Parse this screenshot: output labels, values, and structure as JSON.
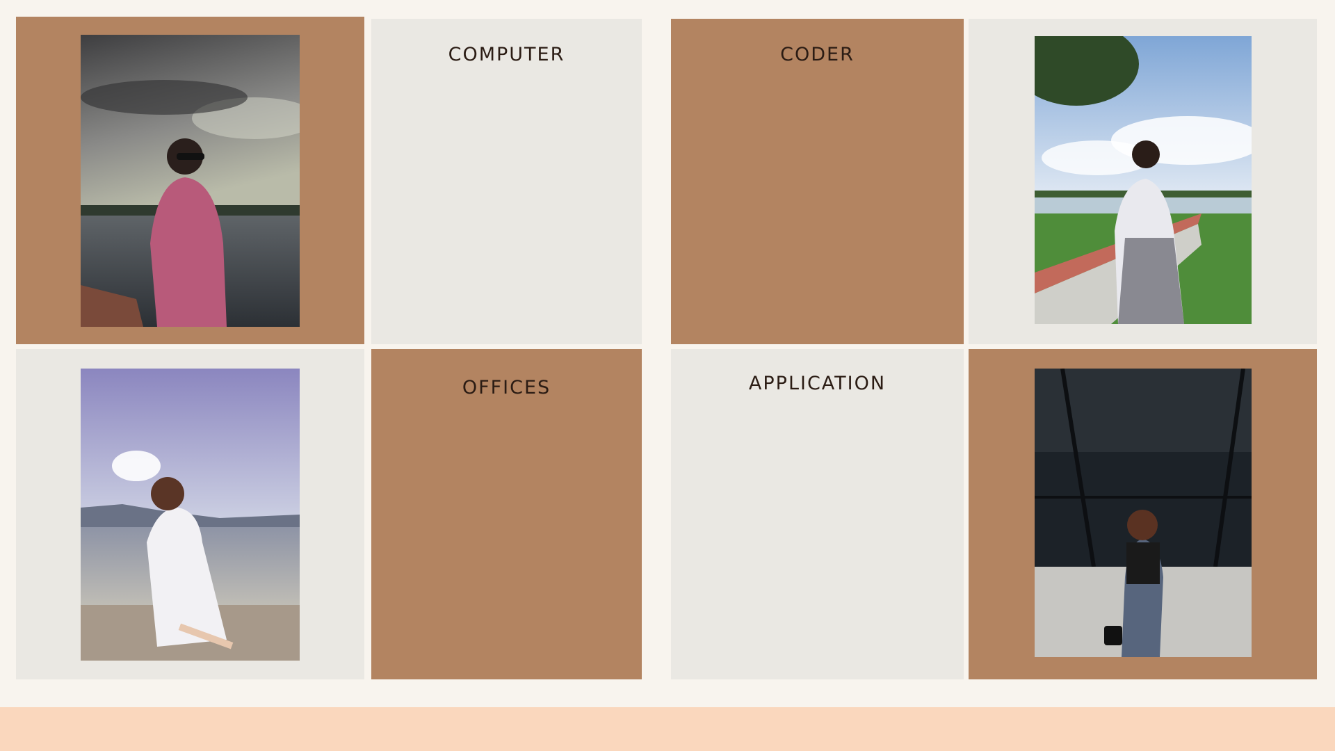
{
  "colors": {
    "page_background": "#f8f4ee",
    "tile_brown": "#b38461",
    "tile_gray": "#eae8e3",
    "label_text": "#2b1c14",
    "footer_band": "#fad7bd"
  },
  "grid": {
    "row_1": [
      {
        "kind": "photo",
        "subject": "person-by-lake-overcast"
      },
      {
        "kind": "label",
        "text": "COMPUTER"
      },
      {
        "kind": "label",
        "text": "CODER"
      },
      {
        "kind": "photo",
        "subject": "person-on-bench-by-lake"
      }
    ],
    "row_2": [
      {
        "kind": "photo",
        "subject": "person-on-beach"
      },
      {
        "kind": "label",
        "text": "OFFICES"
      },
      {
        "kind": "label",
        "text": "APPLICATION"
      },
      {
        "kind": "photo",
        "subject": "person-by-glass-wall"
      }
    ]
  }
}
